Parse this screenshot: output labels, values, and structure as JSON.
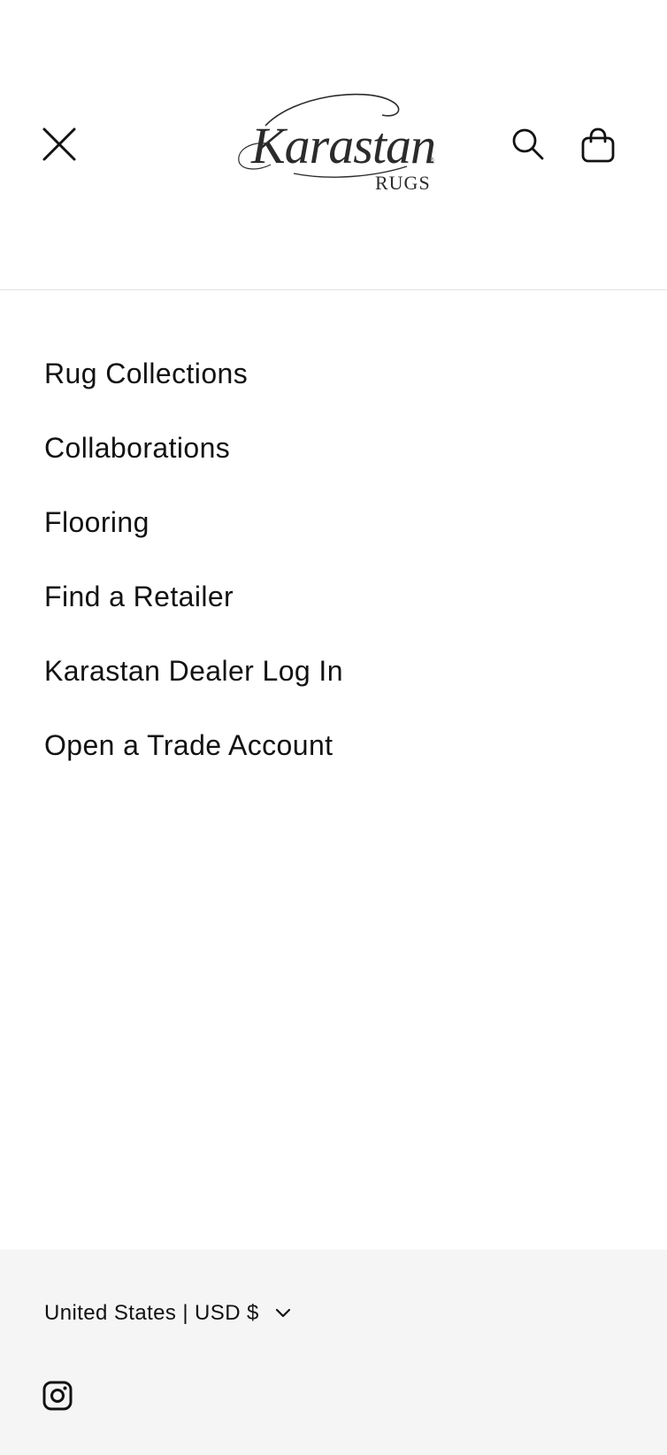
{
  "header": {
    "logo": {
      "brand": "Karastan",
      "sub": "RUGS",
      "registered_mark": "®"
    },
    "icons": {
      "close": "close-icon",
      "search": "search-icon",
      "cart": "cart-icon"
    }
  },
  "menu": {
    "items": [
      {
        "label": "Rug Collections"
      },
      {
        "label": "Collaborations"
      },
      {
        "label": "Flooring"
      },
      {
        "label": "Find a Retailer"
      },
      {
        "label": "Karastan Dealer Log In"
      },
      {
        "label": "Open a Trade Account"
      }
    ]
  },
  "footer": {
    "locale_label": "United States | USD $",
    "icons": {
      "locale_chevron": "chevron-down-icon",
      "instagram": "instagram-icon"
    }
  },
  "colors": {
    "text": "#121212",
    "footer_bg": "#f5f5f5",
    "divider": "#e3e3e3",
    "logo": "#2b2b2b"
  }
}
